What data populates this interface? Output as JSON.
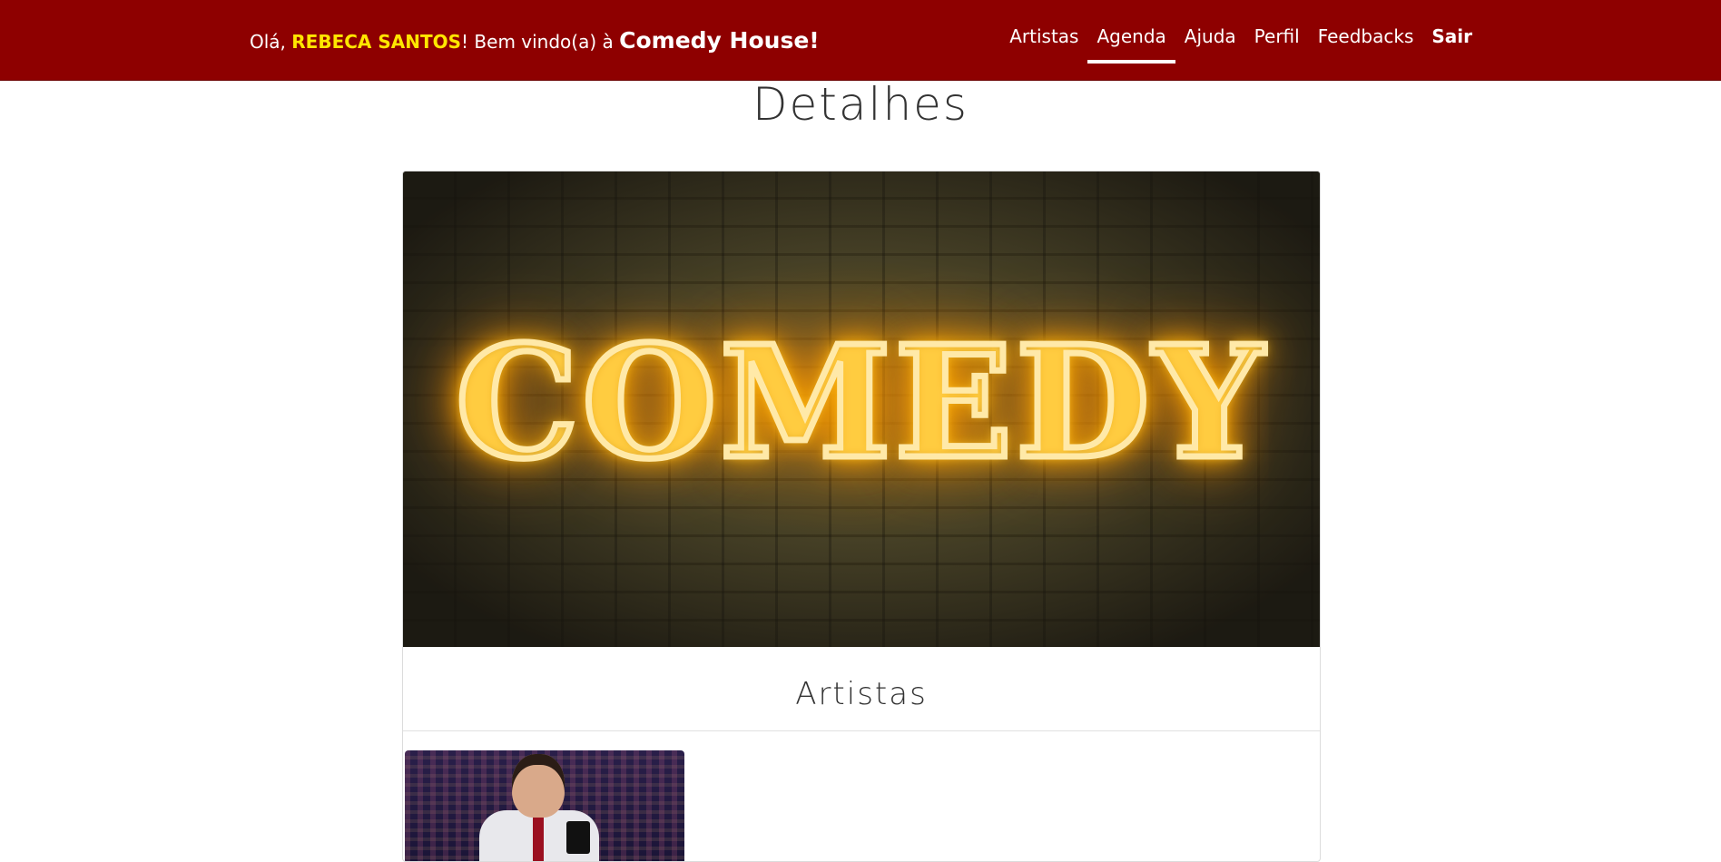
{
  "header": {
    "greeting_prefix": "Olá, ",
    "user_name": "REBECA SANTOS",
    "greeting_mid": "! Bem vindo(a) à ",
    "brand": "Comedy House!",
    "nav": [
      {
        "label": "Artistas",
        "active": false
      },
      {
        "label": "Agenda",
        "active": true
      },
      {
        "label": "Ajuda",
        "active": false
      },
      {
        "label": "Perfil",
        "active": false
      },
      {
        "label": "Feedbacks",
        "active": false
      },
      {
        "label": "Sair",
        "active": false
      }
    ]
  },
  "main": {
    "title": "Detalhes",
    "banner_text": "COMEDY",
    "section_title": "Artistas"
  },
  "colors": {
    "navbar_bg": "#8e0000",
    "user_highlight": "#ffe600"
  }
}
